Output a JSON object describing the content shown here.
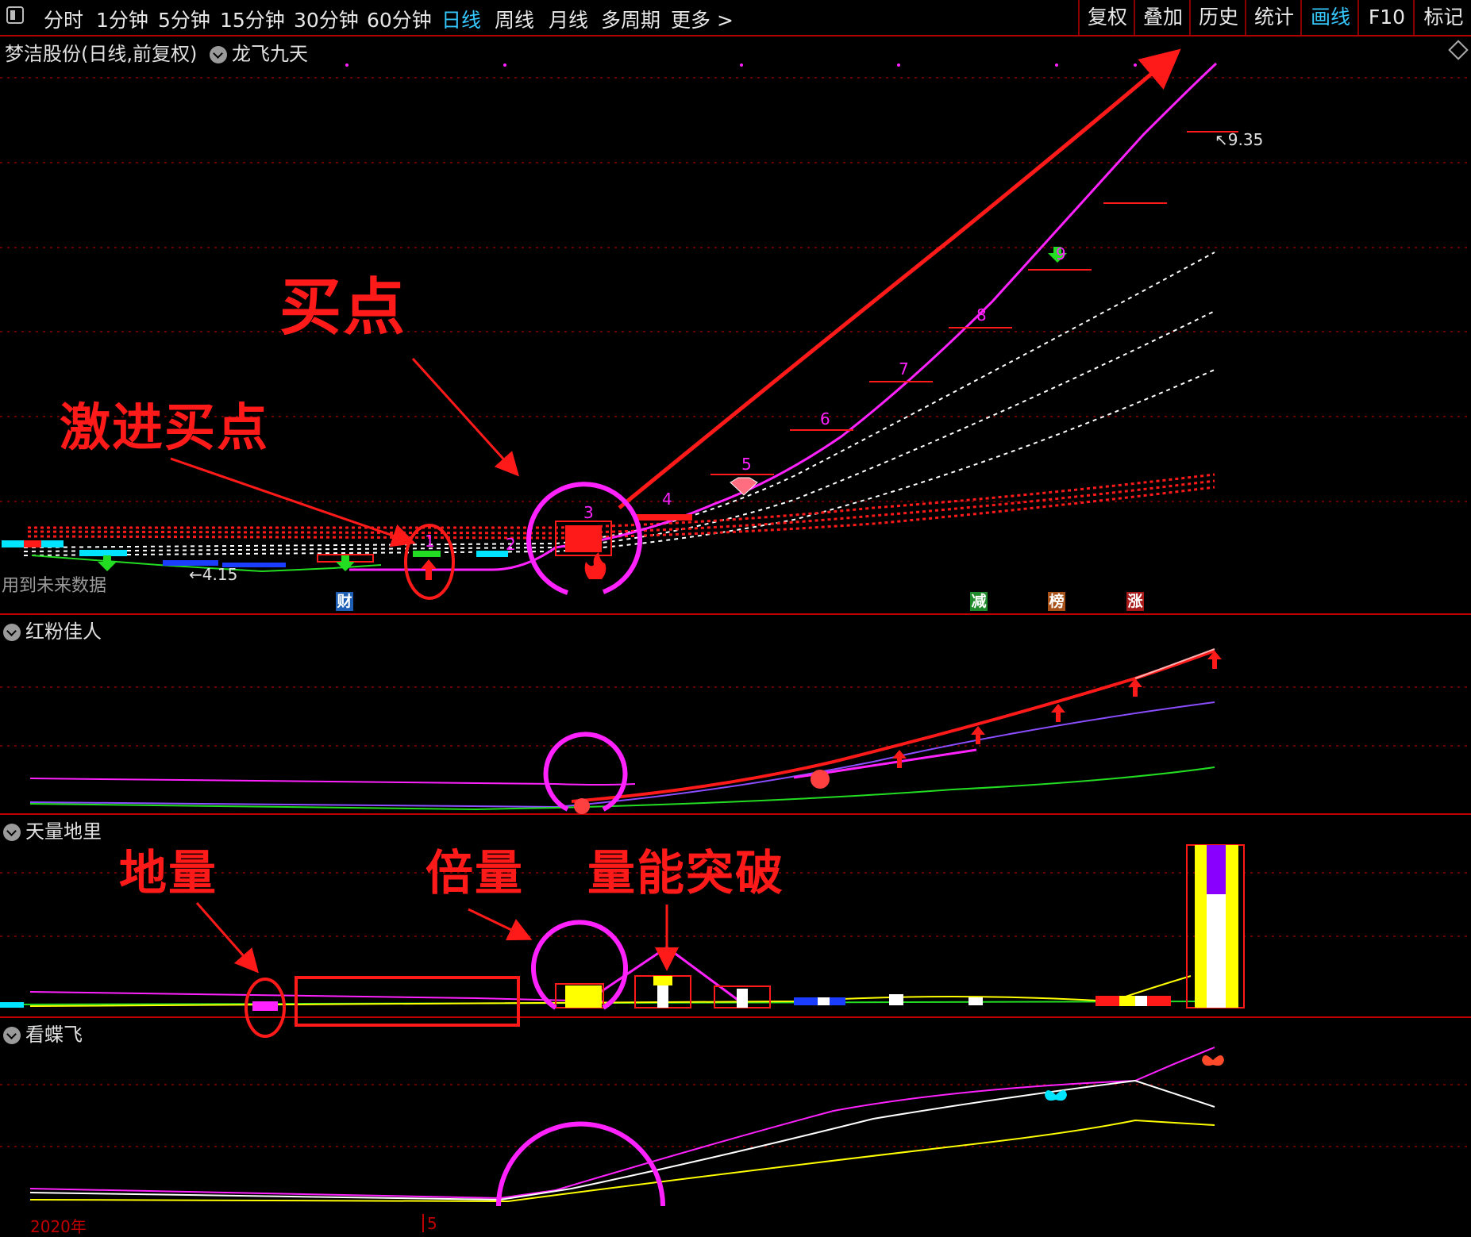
{
  "toolbar": {
    "periods": [
      "分时",
      "1分钟",
      "5分钟",
      "15分钟",
      "30分钟",
      "60分钟",
      "日线",
      "周线",
      "月线",
      "多周期",
      "更多 >"
    ],
    "active_period": "日线",
    "tools": [
      "复权",
      "叠加",
      "历史",
      "统计",
      "画线",
      "F10",
      "标记"
    ],
    "active_tool": "画线"
  },
  "main_panel": {
    "title": "梦洁股份(日线,前复权)",
    "indicator": "龙飞九天",
    "price_high": "9.35",
    "price_low": "4.15",
    "future_data_note": "用到未来数据",
    "count_labels": [
      "1",
      "2",
      "3",
      "4",
      "5",
      "6",
      "7",
      "8",
      "9"
    ],
    "event_badges": [
      {
        "text": "财",
        "color": "#1e5fb5"
      },
      {
        "text": "减",
        "color": "#1f8a2b"
      },
      {
        "text": "榜",
        "color": "#a8521a"
      },
      {
        "text": "涨",
        "color": "#a81a1a"
      }
    ]
  },
  "panel2": {
    "title": "红粉佳人"
  },
  "panel3": {
    "title": "天量地里"
  },
  "panel4": {
    "title": "看蝶飞"
  },
  "x_axis": {
    "year_label": "2020年",
    "month_label": "5"
  },
  "annotations": {
    "buy_point": "买点",
    "aggressive_buy_point": "激进买点",
    "ground_volume": "地量",
    "double_volume": "倍量",
    "volume_breakout": "量能突破"
  },
  "colors": {
    "accent_red": "#ff1a1a",
    "magenta": "#ff22ff",
    "active_blue": "#35c8ff",
    "grid_red": "#8a0000"
  }
}
